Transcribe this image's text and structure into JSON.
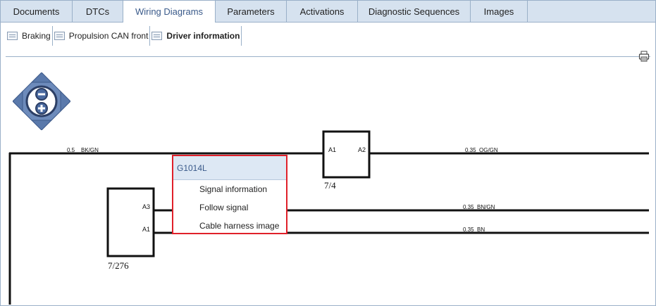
{
  "tabs": [
    {
      "label": "Documents"
    },
    {
      "label": "DTCs"
    },
    {
      "label": "Wiring Diagrams"
    },
    {
      "label": "Parameters"
    },
    {
      "label": "Activations"
    },
    {
      "label": "Diagnostic Sequences"
    },
    {
      "label": "Images"
    }
  ],
  "active_tab": "Wiring Diagrams",
  "subtabs": [
    {
      "label": "Braking"
    },
    {
      "label": "Propulsion CAN front"
    },
    {
      "label": "Driver information"
    }
  ],
  "diagram": {
    "wires": {
      "top_left": "0.5    BK/GN",
      "top_right": "0.35  OG/GN",
      "mid": "0.35  BN/GN",
      "bottom": "0.35  BN"
    },
    "component_a": {
      "label": "7/4",
      "pin_left": "A1",
      "pin_right": "A2"
    },
    "component_b": {
      "label": "7/276",
      "pin_top": "A3",
      "pin_bottom": "A1"
    }
  },
  "context_menu": {
    "title": "G1014L",
    "items": [
      {
        "label": "Signal information"
      },
      {
        "label": "Follow signal"
      },
      {
        "label": "Cable harness image"
      }
    ]
  },
  "icons": {
    "printer": "printer-icon",
    "subtab": "diagram-icon",
    "navigation": "zoom-pan-navigator-icon"
  },
  "colors": {
    "accent": "#3a5a8a",
    "tabbar": "#d6e2ef",
    "highlight_border": "#e0202a",
    "nav_blue": "#5a79ab"
  }
}
